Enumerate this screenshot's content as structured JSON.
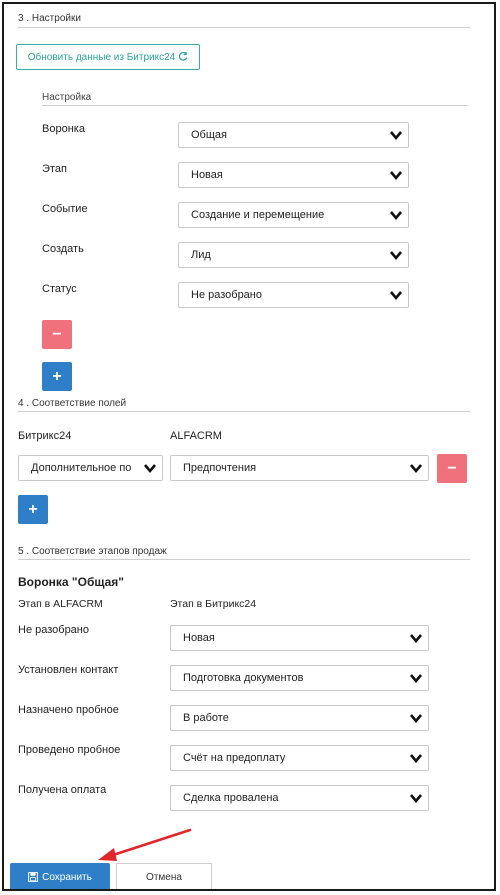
{
  "sec3": {
    "title": "3 . Настройки",
    "refresh_label": "Обновить данные из Битрикс24",
    "group_title": "Настройка",
    "rows": [
      {
        "label": "Воронка",
        "value": "Общая"
      },
      {
        "label": "Этап",
        "value": "Новая"
      },
      {
        "label": "Событие",
        "value": "Создание и перемещение"
      },
      {
        "label": "Создать",
        "value": "Лид"
      },
      {
        "label": "Статус",
        "value": "Не разобрано"
      }
    ],
    "remove_label": "−",
    "add_label": "+"
  },
  "sec4": {
    "title": "4 . Соответствие полей",
    "col1": "Битрикс24",
    "col2": "ALFACRM",
    "field_left": "Дополнительное по",
    "field_right": "Предпочтения",
    "remove_label": "−",
    "add_label": "+"
  },
  "sec5": {
    "title": "5 . Соответствие этапов продаж",
    "funnel_title": "Воронка \"Общая\"",
    "col1": "Этап в ALFACRM",
    "col2": "Этап в Битрикс24",
    "rows": [
      {
        "label": "Не разобрано",
        "value": "Новая"
      },
      {
        "label": "Установлен контакт",
        "value": "Подготовка документов"
      },
      {
        "label": "Назначено пробное",
        "value": "В работе"
      },
      {
        "label": "Проведено пробное",
        "value": "Счёт на предоплату"
      },
      {
        "label": "Получена оплата",
        "value": "Сделка провалена"
      }
    ]
  },
  "footer": {
    "save_label": "Сохранить",
    "cancel_label": "Отмена"
  },
  "colors": {
    "accent_blue": "#2f7fc8",
    "danger_red": "#f0707c",
    "teal": "#2aa396",
    "annotation_red": "#e0262b"
  },
  "icons": [
    "refresh-icon",
    "chevron-down-icon",
    "save-icon",
    "annotation-arrow"
  ]
}
